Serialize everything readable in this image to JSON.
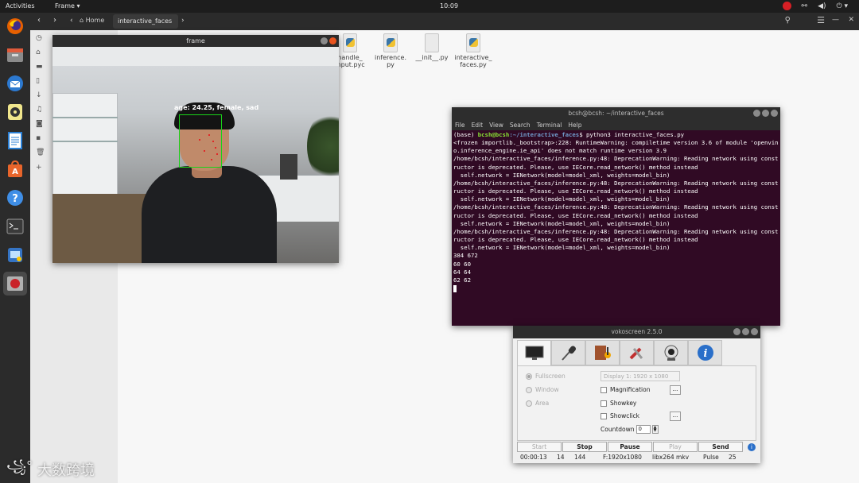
{
  "topbar": {
    "activities": "Activities",
    "app": "Frame ▾",
    "clock": "10:09"
  },
  "nautilus": {
    "home": "Home",
    "current_folder": "interactive_faces",
    "files": [
      {
        "line1": "handle_",
        "line2": "input.pyc"
      },
      {
        "line1": "inference.",
        "line2": "py"
      },
      {
        "line1": "__init__.py",
        "line2": ""
      },
      {
        "line1": "interactive_",
        "line2": "faces.py"
      }
    ]
  },
  "frame_window": {
    "title": "frame",
    "face_label": "age: 24.25, female, sad"
  },
  "terminal": {
    "title": "bcsh@bcsh: ~/interactive_faces",
    "menu": [
      "File",
      "Edit",
      "View",
      "Search",
      "Terminal",
      "Help"
    ],
    "prompt_env": "(base) ",
    "prompt_user": "bcsh@bcsh",
    "prompt_path": ":~/interactive_faces",
    "prompt_cmd": "$ python3 interactive_faces.py",
    "lines": [
      "<frozen importlib._bootstrap>:228: RuntimeWarning: compiletime version 3.6 of module 'openvino.inference_engine.ie_api' does not match runtime version 3.9",
      "/home/bcsh/interactive_faces/inference.py:48: DeprecationWarning: Reading network using constructor is deprecated. Please, use IECore.read_network() method instead",
      "  self.network = IENetwork(model=model_xml, weights=model_bin)",
      "/home/bcsh/interactive_faces/inference.py:48: DeprecationWarning: Reading network using constructor is deprecated. Please, use IECore.read_network() method instead",
      "  self.network = IENetwork(model=model_xml, weights=model_bin)",
      "/home/bcsh/interactive_faces/inference.py:48: DeprecationWarning: Reading network using constructor is deprecated. Please, use IECore.read_network() method instead",
      "  self.network = IENetwork(model=model_xml, weights=model_bin)",
      "/home/bcsh/interactive_faces/inference.py:48: DeprecationWarning: Reading network using constructor is deprecated. Please, use IECore.read_network() method instead",
      "  self.network = IENetwork(model=model_xml, weights=model_bin)",
      "384 672",
      "60 60",
      "64 64",
      "62 62"
    ]
  },
  "vokoscreen": {
    "title": "vokoscreen 2.5.0",
    "tabs": [
      "monitor-icon",
      "microphone-icon",
      "film-icon",
      "tools-icon",
      "webcam-icon",
      "info-icon"
    ],
    "radios": {
      "fullscreen": "Fullscreen",
      "window": "Window",
      "area": "Area"
    },
    "display_select": "Display 1:  1920 x 1080",
    "checks": {
      "magnification": "Magnification",
      "showkey": "Showkey",
      "showclick": "Showclick"
    },
    "dots": "...",
    "countdown_label": "Countdown",
    "countdown_value": "0",
    "buttons": {
      "start": "Start",
      "stop": "Stop",
      "pause": "Pause",
      "play": "Play",
      "send": "Send"
    },
    "status": {
      "time": "00:00:13",
      "fps": "14",
      "frames": "144",
      "format": "F:1920x1080",
      "codec": "libx264",
      "container": "mkv",
      "audio": "Pulse",
      "value": "25"
    }
  },
  "watermark": {
    "text": "大数跨境"
  },
  "colors": {
    "terminal_bg": "#300a24",
    "record_dot": "#d61f25",
    "face_box": "#19d319",
    "landmark": "#e02828"
  }
}
